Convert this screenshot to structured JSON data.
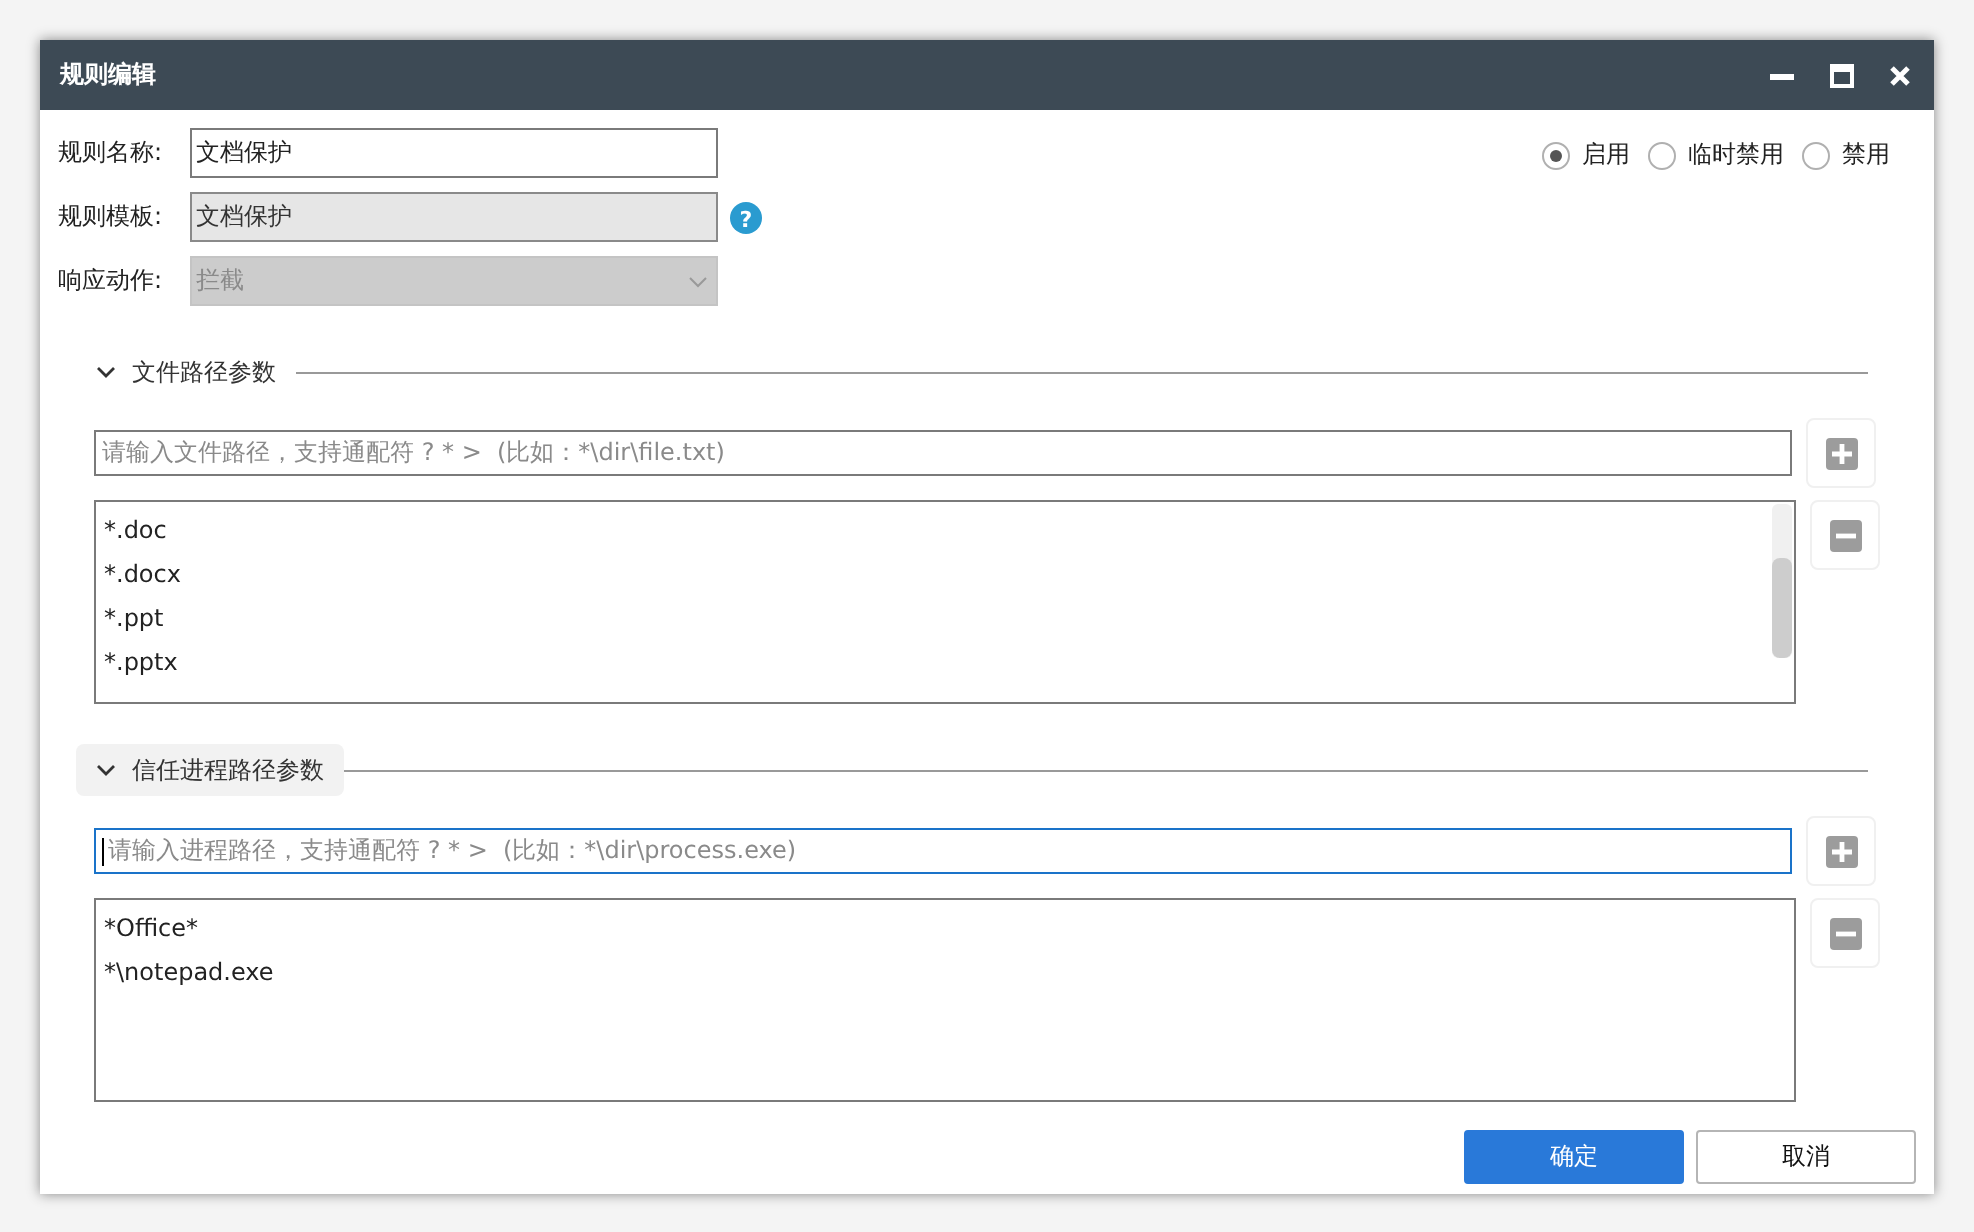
{
  "window": {
    "title": "规则编辑"
  },
  "fields": [
    {
      "kind": "text",
      "label": "规则名称:",
      "value": "文档保护",
      "disabled": false
    },
    {
      "kind": "text",
      "label": "规则模板:",
      "value": "文档保护",
      "disabled": true,
      "help": "?"
    },
    {
      "kind": "select",
      "label": "响应动作:",
      "value": "拦截",
      "disabled": true
    }
  ],
  "status_options": [
    {
      "label": "启用",
      "selected": true
    },
    {
      "label": "临时禁用",
      "selected": false
    },
    {
      "label": "禁用",
      "selected": false
    }
  ],
  "sections": [
    {
      "title": "文件路径参数",
      "expanded": true,
      "hovered": false,
      "input": {
        "placeholder": "请输入文件路径，支持通配符 ? * >  (比如：*\\dir\\file.txt)",
        "focused": false
      },
      "items": [
        "*.doc",
        "*.docx",
        "*.ppt",
        "*.pptx"
      ],
      "scrollable": true
    },
    {
      "title": "信任进程路径参数",
      "expanded": true,
      "hovered": true,
      "input": {
        "placeholder": "请输入进程路径，支持通配符 ? * >  (比如：*\\dir\\process.exe)",
        "focused": true
      },
      "items": [
        "*Office*",
        "*\\notepad.exe"
      ],
      "scrollable": false
    }
  ],
  "buttons": [
    {
      "label": "确定",
      "kind": "primary"
    },
    {
      "label": "取消",
      "kind": "secondary"
    }
  ]
}
